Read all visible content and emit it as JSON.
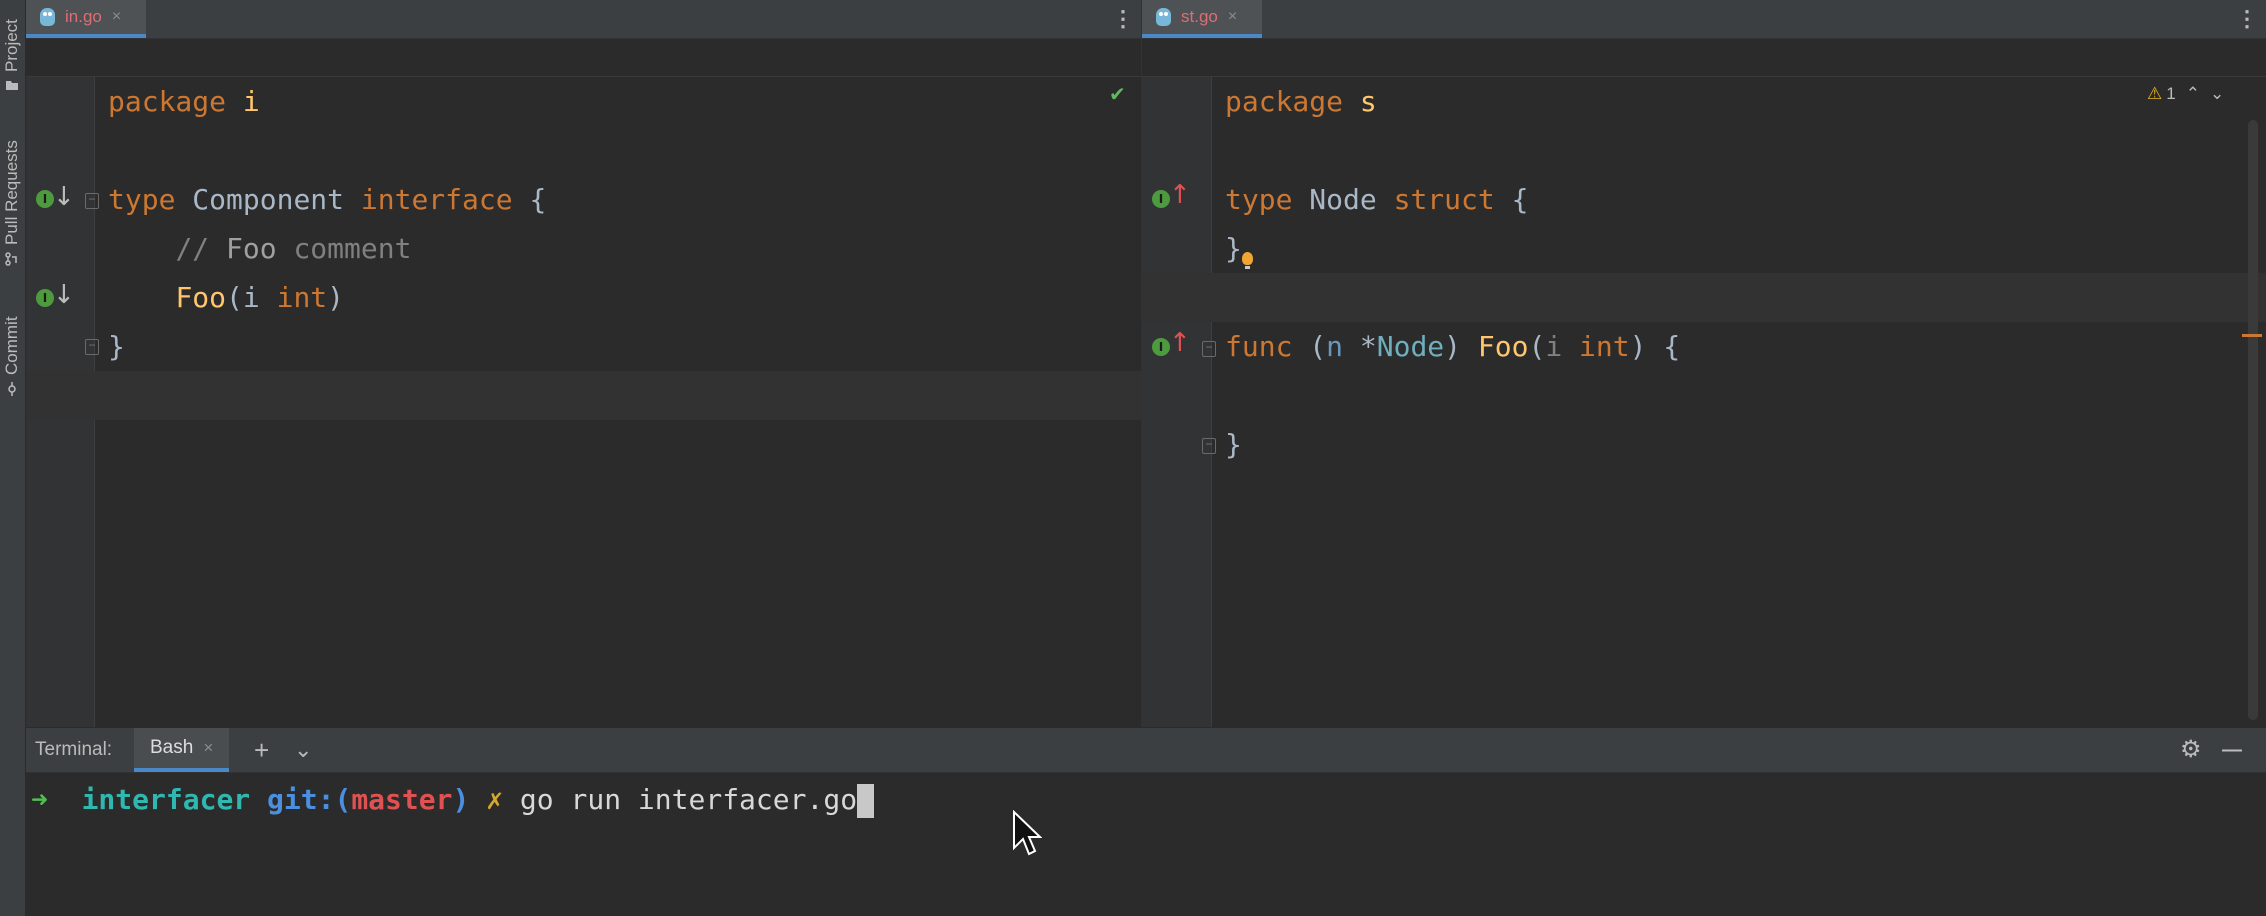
{
  "tool_strip": {
    "project": "Project",
    "pull_requests": "Pull Requests",
    "commit": "Commit"
  },
  "left_editor": {
    "tab": {
      "filename": "in.go",
      "close": "×",
      "icon": "go-file-icon"
    },
    "menu": "⋮",
    "status": "✔",
    "code": {
      "l1": {
        "kw": "package",
        "name": "i"
      },
      "l3": {
        "kw": "type",
        "name": "Component",
        "kw2": "interface",
        "brace": "{"
      },
      "l4": {
        "slashes": "//",
        "word": "Foo",
        "rest": "comment"
      },
      "l5": {
        "fn": "Foo",
        "open": "(",
        "param": "i",
        "type": "int",
        "close": ")"
      },
      "l6": {
        "brace": "}"
      }
    }
  },
  "right_editor": {
    "tab": {
      "filename": "st.go",
      "close": "×",
      "icon": "go-file-icon"
    },
    "menu": "⋮",
    "warnings": {
      "icon": "warning-triangle-icon",
      "count": "1",
      "up": "⌃",
      "down": "⌄"
    },
    "code": {
      "l1": {
        "kw": "package",
        "name": "s"
      },
      "l3": {
        "kw": "type",
        "name": "Node",
        "kw2": "struct",
        "brace": "{"
      },
      "l4": {
        "brace": "}"
      },
      "l6": {
        "kw": "func",
        "open": "(",
        "recv": "n",
        "star": "*",
        "rtype": "Node",
        "close": ")",
        "fn": "Foo",
        "popen": "(",
        "param": "i",
        "ptype": "int",
        "pclose": ")",
        "brace": "{"
      },
      "l8": {
        "brace": "}"
      }
    }
  },
  "terminal": {
    "label": "Terminal:",
    "tab": "Bash",
    "tab_close": "×",
    "add": "+",
    "dropdown": "⌄",
    "settings": "⚙",
    "minimize": "—",
    "prompt": {
      "arrow": "➜",
      "dir": "interfacer",
      "git": "git:(",
      "branch": "master",
      "git_close": ")",
      "dirty": "✗",
      "command": "go run interfacer.go"
    }
  }
}
